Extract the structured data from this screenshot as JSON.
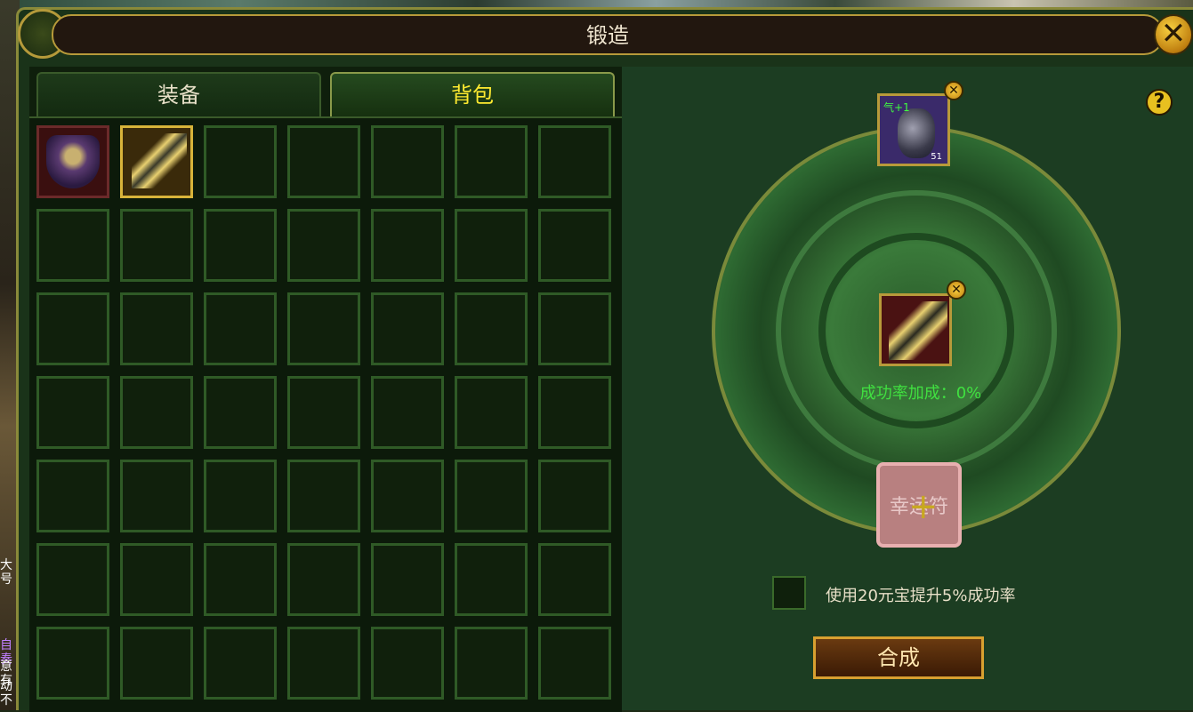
{
  "window": {
    "title": "锻造"
  },
  "tabs": [
    {
      "label": "装备",
      "active": false
    },
    {
      "label": "背包",
      "active": true
    }
  ],
  "inventory": {
    "rows": 7,
    "cols": 7,
    "items": [
      {
        "name": "armor-item",
        "row": 0,
        "col": 0
      },
      {
        "name": "sword-item",
        "row": 0,
        "col": 1,
        "selected": true
      }
    ]
  },
  "forge": {
    "gem_slot": {
      "label": "气+1",
      "count": "51"
    },
    "weapon_slot": {
      "item": "sword-item"
    },
    "success_bonus_label": "成功率加成：0%",
    "lucky_charm_label": "幸运符",
    "yuanbao_option_label": "使用20元宝提升5%成功率",
    "combine_label": "合成"
  },
  "background": {
    "left_fragments": [
      "大号",
      "自奏",
      "意有",
      "动不"
    ]
  },
  "colors": {
    "accent_gold": "#d8b43a",
    "success_green": "#40e040",
    "active_tab_text": "#ffea30"
  }
}
